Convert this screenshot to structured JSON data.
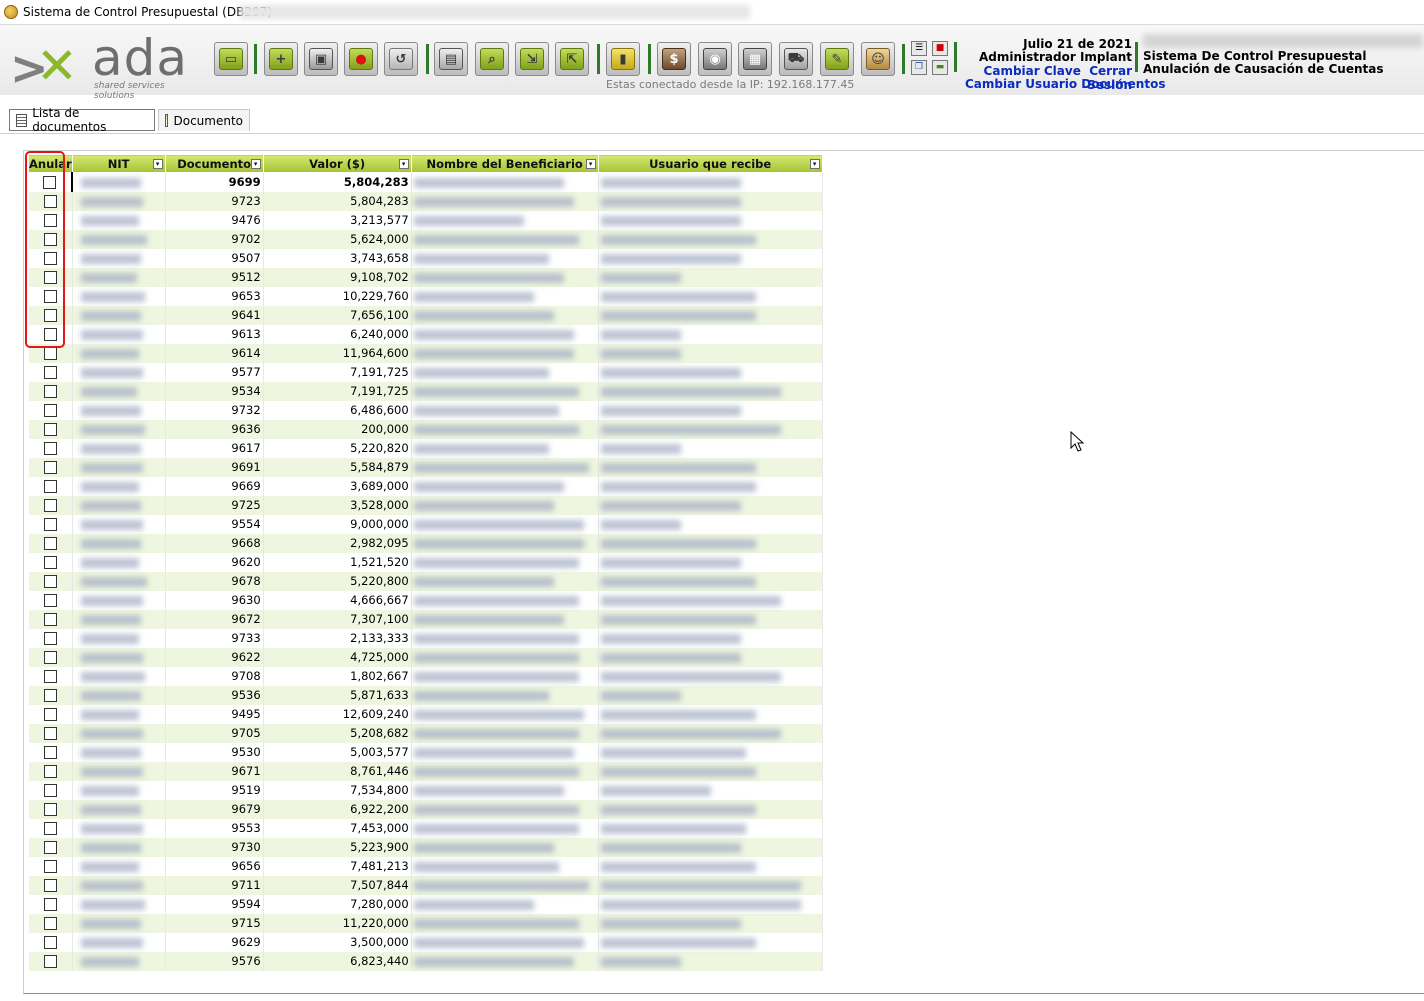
{
  "window": {
    "title": "Sistema de Control Presupuestal (DB207)"
  },
  "header": {
    "logo_text": "ada",
    "logo_tagline": "shared services solutions",
    "ip_info": "Estas conectado desde la IP: 192.168.177.45",
    "date": "Julio 21 de 2021",
    "user_name": "Administrador Implant",
    "change_password_link": "Cambiar Clave",
    "logout_link": "Cerrar Sesión",
    "change_user_docs_link": "Cambiar Usuario Documentos",
    "system_name": "Sistema De Control Presupuestal",
    "module_name": "Anulación de Causación de Cuentas"
  },
  "toolbar": {
    "buttons": [
      "folder-open",
      "new-document",
      "save",
      "delete",
      "undo",
      "print",
      "search",
      "export-excel",
      "import",
      "lock",
      "money",
      "camera",
      "layout",
      "cart",
      "notes",
      "users"
    ]
  },
  "tabs": [
    {
      "label": "Lista de documentos"
    },
    {
      "label": "Documento"
    }
  ],
  "grid": {
    "columns": {
      "anular": "Anular",
      "nit": "NIT",
      "documento": "Documento",
      "valor": "Valor ($)",
      "beneficiario": "Nombre del Beneficiario",
      "usuario": "Usuario que recibe"
    },
    "rows": [
      {
        "doc": "9699",
        "val": "5,804,283"
      },
      {
        "doc": "9723",
        "val": "5,804,283"
      },
      {
        "doc": "9476",
        "val": "3,213,577"
      },
      {
        "doc": "9702",
        "val": "5,624,000"
      },
      {
        "doc": "9507",
        "val": "3,743,658"
      },
      {
        "doc": "9512",
        "val": "9,108,702"
      },
      {
        "doc": "9653",
        "val": "10,229,760"
      },
      {
        "doc": "9641",
        "val": "7,656,100"
      },
      {
        "doc": "9613",
        "val": "6,240,000"
      },
      {
        "doc": "9614",
        "val": "11,964,600"
      },
      {
        "doc": "9577",
        "val": "7,191,725"
      },
      {
        "doc": "9534",
        "val": "7,191,725"
      },
      {
        "doc": "9732",
        "val": "6,486,600"
      },
      {
        "doc": "9636",
        "val": "200,000"
      },
      {
        "doc": "9617",
        "val": "5,220,820"
      },
      {
        "doc": "9691",
        "val": "5,584,879"
      },
      {
        "doc": "9669",
        "val": "3,689,000"
      },
      {
        "doc": "9725",
        "val": "3,528,000"
      },
      {
        "doc": "9554",
        "val": "9,000,000"
      },
      {
        "doc": "9668",
        "val": "2,982,095"
      },
      {
        "doc": "9620",
        "val": "1,521,520"
      },
      {
        "doc": "9678",
        "val": "5,220,800"
      },
      {
        "doc": "9630",
        "val": "4,666,667"
      },
      {
        "doc": "9672",
        "val": "7,307,100"
      },
      {
        "doc": "9733",
        "val": "2,133,333"
      },
      {
        "doc": "9622",
        "val": "4,725,000"
      },
      {
        "doc": "9708",
        "val": "1,802,667"
      },
      {
        "doc": "9536",
        "val": "5,871,633"
      },
      {
        "doc": "9495",
        "val": "12,609,240"
      },
      {
        "doc": "9705",
        "val": "5,208,682"
      },
      {
        "doc": "9530",
        "val": "5,003,577"
      },
      {
        "doc": "9671",
        "val": "8,761,446"
      },
      {
        "doc": "9519",
        "val": "7,534,800"
      },
      {
        "doc": "9679",
        "val": "6,922,200"
      },
      {
        "doc": "9553",
        "val": "7,453,000"
      },
      {
        "doc": "9730",
        "val": "5,223,900"
      },
      {
        "doc": "9656",
        "val": "7,481,213"
      },
      {
        "doc": "9711",
        "val": "7,507,844"
      },
      {
        "doc": "9594",
        "val": "7,280,000"
      },
      {
        "doc": "9715",
        "val": "11,220,000"
      },
      {
        "doc": "9629",
        "val": "3,500,000"
      },
      {
        "doc": "9576",
        "val": "6,823,440"
      }
    ]
  }
}
